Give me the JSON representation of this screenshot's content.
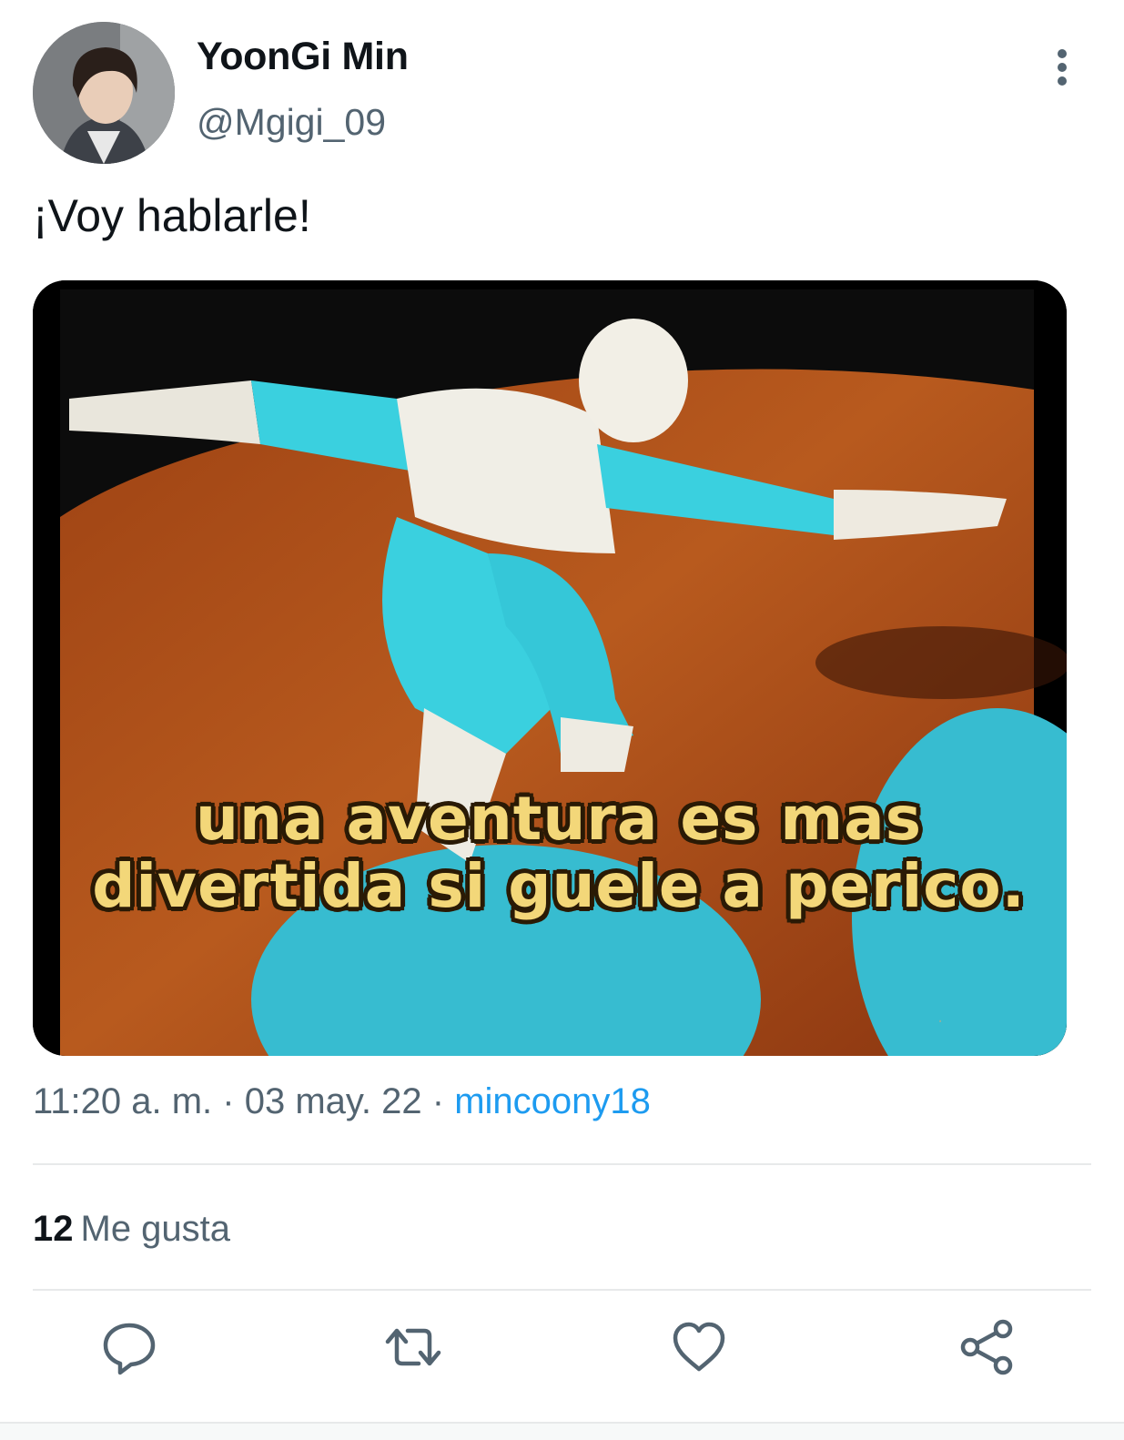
{
  "tweet": {
    "author": {
      "display_name": "YoonGi Min",
      "handle": "@Mgigi_09"
    },
    "text": "¡Voy hablarle!",
    "media": {
      "caption": "una aventura es mas divertida si guele a perico."
    },
    "meta": {
      "time": "11:20 a. m.",
      "separator": "·",
      "date": "03 may. 22",
      "source": "mincoony18"
    },
    "likes": {
      "count": "12",
      "label": "Me gusta"
    }
  },
  "icons": {
    "more": "more-vertical-icon",
    "reply": "reply-icon",
    "retweet": "retweet-icon",
    "like": "heart-icon",
    "share": "share-icon"
  },
  "colors": {
    "text_primary": "#0f1419",
    "text_secondary": "#536471",
    "link": "#1d9bf0",
    "divider": "#e7e9ea"
  }
}
